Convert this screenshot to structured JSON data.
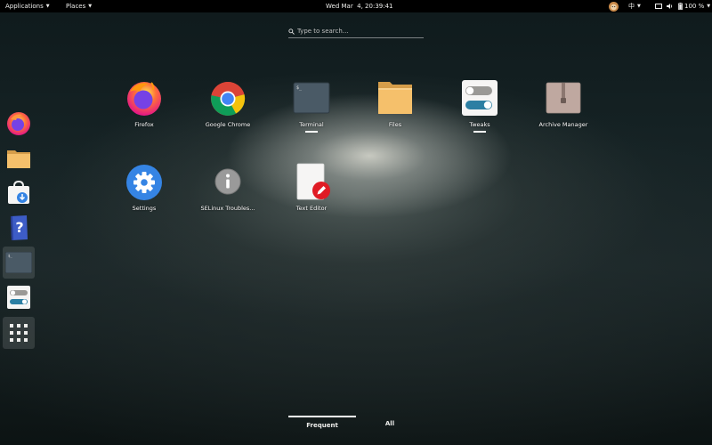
{
  "topbar": {
    "applications": "Applications",
    "places": "Places",
    "clock": "Wed Mar  4, 20:39:41",
    "input_method": "中",
    "battery": "100 %"
  },
  "search": {
    "placeholder": "Type to search…"
  },
  "dash": {
    "items": [
      {
        "name": "firefox",
        "active": false
      },
      {
        "name": "files",
        "active": false
      },
      {
        "name": "software",
        "active": false
      },
      {
        "name": "help",
        "active": false
      },
      {
        "name": "terminal",
        "active": true
      },
      {
        "name": "tweaks",
        "active": false
      },
      {
        "name": "show-applications",
        "active": false
      }
    ]
  },
  "apps": [
    {
      "label": "Firefox",
      "icon": "firefox-icon",
      "running": false
    },
    {
      "label": "Google Chrome",
      "icon": "chrome-icon",
      "running": false
    },
    {
      "label": "Terminal",
      "icon": "terminal-icon",
      "running": true
    },
    {
      "label": "Files",
      "icon": "folder-icon",
      "running": false
    },
    {
      "label": "Tweaks",
      "icon": "tweaks-icon",
      "running": true
    },
    {
      "label": "Archive Manager",
      "icon": "archive-icon",
      "running": false
    },
    {
      "label": "Settings",
      "icon": "gear-icon",
      "running": false
    },
    {
      "label": "SELinux Troubles...",
      "icon": "info-icon",
      "running": false
    },
    {
      "label": "Text Editor",
      "icon": "text-editor-icon",
      "running": false
    }
  ],
  "tabs": {
    "frequent": "Frequent",
    "all": "All",
    "selected": "Frequent"
  },
  "colors": {
    "topbar_bg": "#000000",
    "folder": "#f5c06b",
    "chrome_red": "#db4437",
    "chrome_yellow": "#f4c20d",
    "chrome_green": "#0f9d58",
    "chrome_blue": "#4285f4",
    "settings_blue": "#3584e4",
    "editor_red": "#e01b24"
  }
}
